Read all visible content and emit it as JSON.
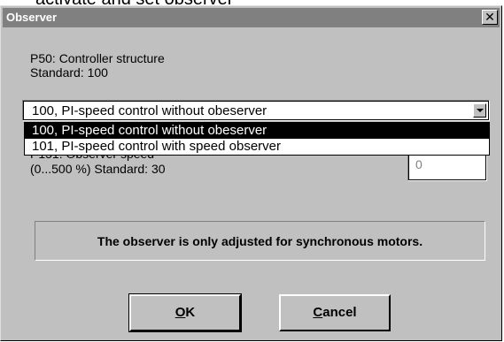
{
  "caption": "activate and set observer",
  "dialog": {
    "title": "Observer",
    "close_glyph": "✕"
  },
  "p50": {
    "label": "P50: Controller structure",
    "standard": "Standard: 100"
  },
  "controller_combo": {
    "value": "100, PI-speed control without obeserver",
    "options": [
      "100, PI-speed control without obeserver",
      "101, PI-speed control with speed observer"
    ]
  },
  "p51": {
    "label": "P151: Observer speed",
    "range_standard": "(0...500 %)  Standard: 30",
    "value": "0"
  },
  "info": {
    "text": "The observer is only adjusted for synchronous motors."
  },
  "buttons": {
    "ok_mnemonic": "O",
    "ok_rest": "K",
    "cancel_mnemonic": "C",
    "cancel_rest": "ancel"
  },
  "colors": {
    "face": "#c0c0c0",
    "titlebar": "#808080",
    "selection": "#000000"
  }
}
